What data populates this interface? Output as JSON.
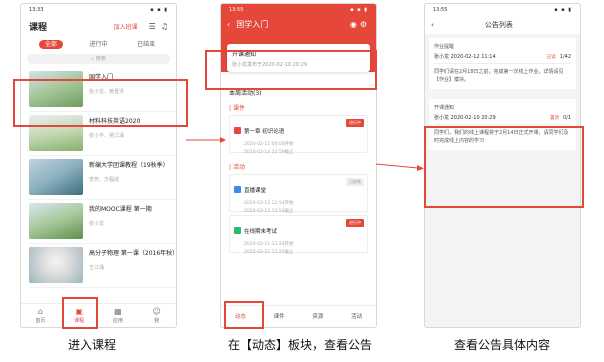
{
  "captions": {
    "step1": "进入课程",
    "step2": "在【动态】板块，查看公告",
    "step3": "查看公告具体内容"
  },
  "phone1": {
    "status_time": "13:33",
    "status_icons": "▪ ▪ ▮",
    "header": {
      "title": "课程",
      "join_label": "加入班课",
      "menu_icon": "list-icon",
      "bell_icon": "bell-icon"
    },
    "tabs": [
      {
        "label": "全部",
        "active": true
      },
      {
        "label": "进行中"
      },
      {
        "label": "已结束"
      }
    ],
    "search_placeholder": "搜索",
    "courses": [
      {
        "title": "国学入门",
        "teacher": "张小龙、黄晋洪"
      },
      {
        "title": "材料科技英语2020",
        "teacher": "张小平、吴江涌"
      },
      {
        "title": "新编大学团课教程（19秋季）",
        "teacher": "李芳、方程成"
      },
      {
        "title": "我的MOOC课程 第一期",
        "teacher": "张小龙"
      },
      {
        "title": "高分子物理 第一课（2016年秋）",
        "teacher": "王江涌"
      }
    ],
    "tabbar": [
      {
        "label": "首页",
        "icon": "home-icon"
      },
      {
        "label": "课程",
        "icon": "course-icon",
        "active": true
      },
      {
        "label": "应用",
        "icon": "apps-icon"
      },
      {
        "label": "我",
        "icon": "user-icon"
      }
    ]
  },
  "phone2": {
    "status_time": "13:55",
    "header": {
      "back": "‹",
      "title": "国学入门",
      "right_icons": "camera-icon settings-icon"
    },
    "notice": {
      "title": "开课通知",
      "meta": "张小龙发布于2020-02-10 20:29"
    },
    "week_title": "本周活动(3)",
    "section_course": "课件",
    "section_activity": "活动",
    "activities": [
      {
        "title": "第一章 初识论语",
        "line1": "2020-02-11 00:00开始",
        "line2": "2020-02-14 23:59截止",
        "tag": "进行中",
        "tag_style": "red",
        "icon": "doc-icon"
      },
      {
        "title": "直播课堂",
        "line1": "2020-02-12 12:54开始",
        "line2": "2020-02-12 13:54截止",
        "tag": "已结束",
        "tag_style": "grey",
        "icon": "live-icon"
      },
      {
        "title": "在线期末考试",
        "line1": "2020-02-11 13:24开始",
        "line2": "2020-02-22 13:25截止",
        "tag": "进行中",
        "tag_style": "red",
        "icon": "exam-icon"
      }
    ],
    "tabbar": [
      {
        "label": "动态",
        "active": true
      },
      {
        "label": "课件"
      },
      {
        "label": "资源"
      },
      {
        "label": "活动"
      }
    ]
  },
  "phone3": {
    "status_time": "13:55",
    "header": {
      "back": "‹",
      "title": "公告列表"
    },
    "notices": [
      {
        "title": "作业提醒",
        "author": "张小龙 2020-02-12 11:14",
        "tag": "已读",
        "count": "1/42",
        "content": "同学们请在2月18日之前，完成第一次线上作业，详情请见【作业】模块。"
      },
      {
        "title": "开课通知",
        "author": "张小龙 2020-02-10 20:29",
        "tag": "置顶",
        "count": "0/1",
        "content": "同学们，我们的线上课程将于2月14日正式开课，请同学们及时完成线上内容的学习"
      }
    ]
  },
  "colors": {
    "accent": "#e5483a",
    "highlight_box": "#e5483a"
  }
}
